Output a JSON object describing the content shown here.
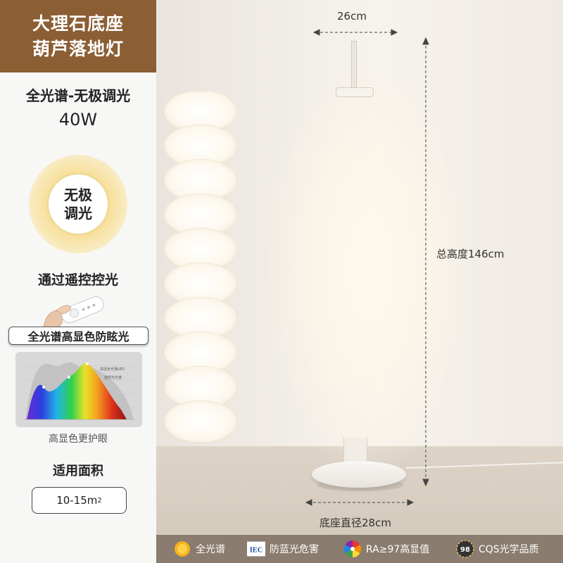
{
  "title": {
    "line1": "大理石底座",
    "line2": "葫芦落地灯"
  },
  "feature": {
    "title": "全光谱-无极调光",
    "power": "40W"
  },
  "dimming": {
    "line1": "无极",
    "line2": "调光"
  },
  "remote": {
    "title": "通过遥控控光"
  },
  "spectrum": {
    "pill": "全光谱高显色防眩光",
    "legend_led": "本店全光谱LED",
    "legend_sun": "自然光光谱",
    "caption": "高显色更护眼"
  },
  "area": {
    "title": "适用面积",
    "value": "10-15m",
    "unit_sup": "2"
  },
  "dimensions": {
    "top_width": "26cm",
    "total_height": "总高度146cm",
    "base_diameter": "底座直径28cm"
  },
  "badges": [
    {
      "icon": "sun-icon",
      "label": "全光谱"
    },
    {
      "icon": "iec-icon",
      "icon_text": "IEC",
      "label": "防蓝光危害"
    },
    {
      "icon": "color-wheel-icon",
      "label": "RA≥97高显值"
    },
    {
      "icon": "cqs-icon",
      "icon_text": "98",
      "label": "CQS光学品质"
    }
  ],
  "colors": {
    "banner": "#8b5e34",
    "bottom_bar": "#8a7c6e",
    "panel": "#f7f7f6"
  }
}
